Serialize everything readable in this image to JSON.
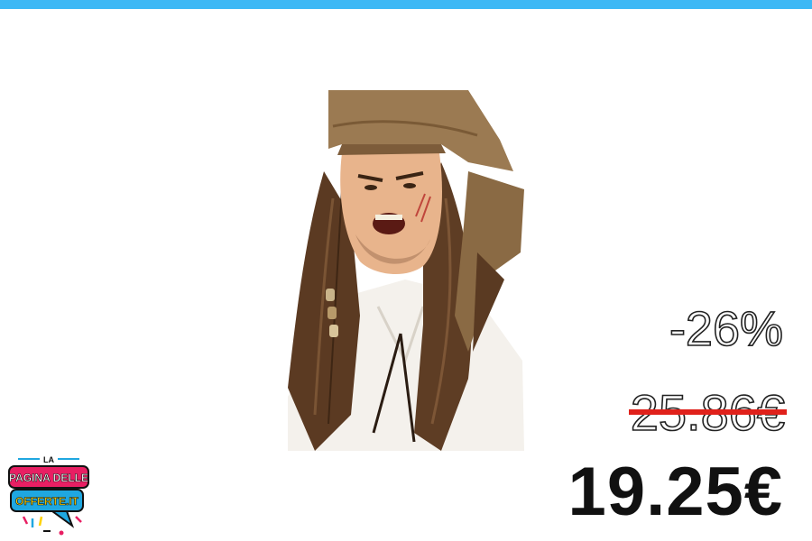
{
  "colors": {
    "top_bar": "#3db8f5",
    "strike": "#e0211b",
    "logo_pink": "#e81f63",
    "logo_blue": "#1fa7e0",
    "logo_yellow": "#ffd200"
  },
  "product": {
    "image_icon": "pirate-wig-bandana-photo",
    "discount": "-26%",
    "old_price": "25.86€",
    "new_price": "19.25€"
  },
  "logo": {
    "top_text": "LA",
    "line1": "PAGINA DELLE",
    "line2": "OFFERTE.IT"
  }
}
